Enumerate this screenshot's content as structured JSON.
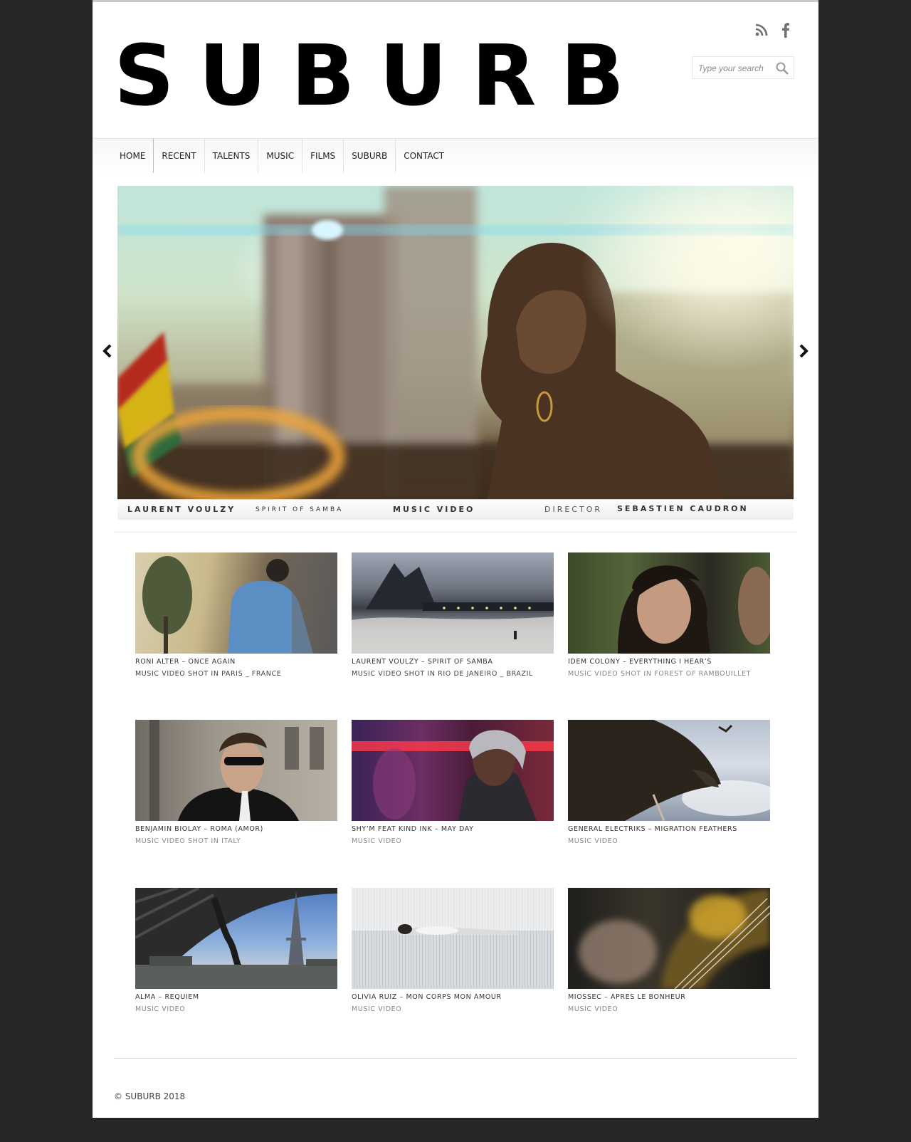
{
  "site": {
    "logo": "SUBURB"
  },
  "header": {
    "social": [
      "rss-icon",
      "facebook-icon"
    ],
    "search": {
      "placeholder": "Type your search"
    }
  },
  "nav": {
    "items": [
      "HOME",
      "RECENT",
      "TALENTS",
      "MUSIC",
      "FILMS",
      "SUBURB",
      "CONTACT"
    ]
  },
  "slider": {
    "artist": "LAURENT VOULZY",
    "title": "SPIRIT OF SAMBA",
    "type": "MUSIC VIDEO",
    "role": "DIRECTOR",
    "director": "SEBASTIEN CAUDRON"
  },
  "grid": [
    {
      "title": "RONI ALTER – ONCE AGAIN",
      "subtitle": "MUSIC VIDEO SHOT IN PARIS _ FRANCE"
    },
    {
      "title": "LAURENT VOULZY – SPIRIT OF SAMBA",
      "subtitle": "MUSIC VIDEO SHOT IN RIO DE JANEIRO _ BRAZIL"
    },
    {
      "title": "IDEM COLONY – EVERYTHING I HEAR’S",
      "subtitle": "MUSIC VIDEO SHOT IN FOREST OF RAMBOUILLET"
    },
    {
      "title": "BENJAMIN BIOLAY – ROMA (AMOR)",
      "subtitle": "MUSIC VIDEO SHOT IN ITALY"
    },
    {
      "title": "SHY’M FEAT KIND INK – MAY DAY",
      "subtitle": "MUSIC VIDEO"
    },
    {
      "title": "GENERAL ELECTRIKS – MIGRATION FEATHERS",
      "subtitle": "MUSIC VIDEO"
    },
    {
      "title": "ALMA – REQUIEM",
      "subtitle": "MUSIC VIDEO"
    },
    {
      "title": "OLIVIA RUIZ – MON CORPS MON AMOUR",
      "subtitle": "MUSIC VIDEO"
    },
    {
      "title": "MIOSSEC – APRES LE BONHEUR",
      "subtitle": "MUSIC VIDEO"
    }
  ],
  "footer": {
    "copyright": "© SUBURB 2018"
  }
}
